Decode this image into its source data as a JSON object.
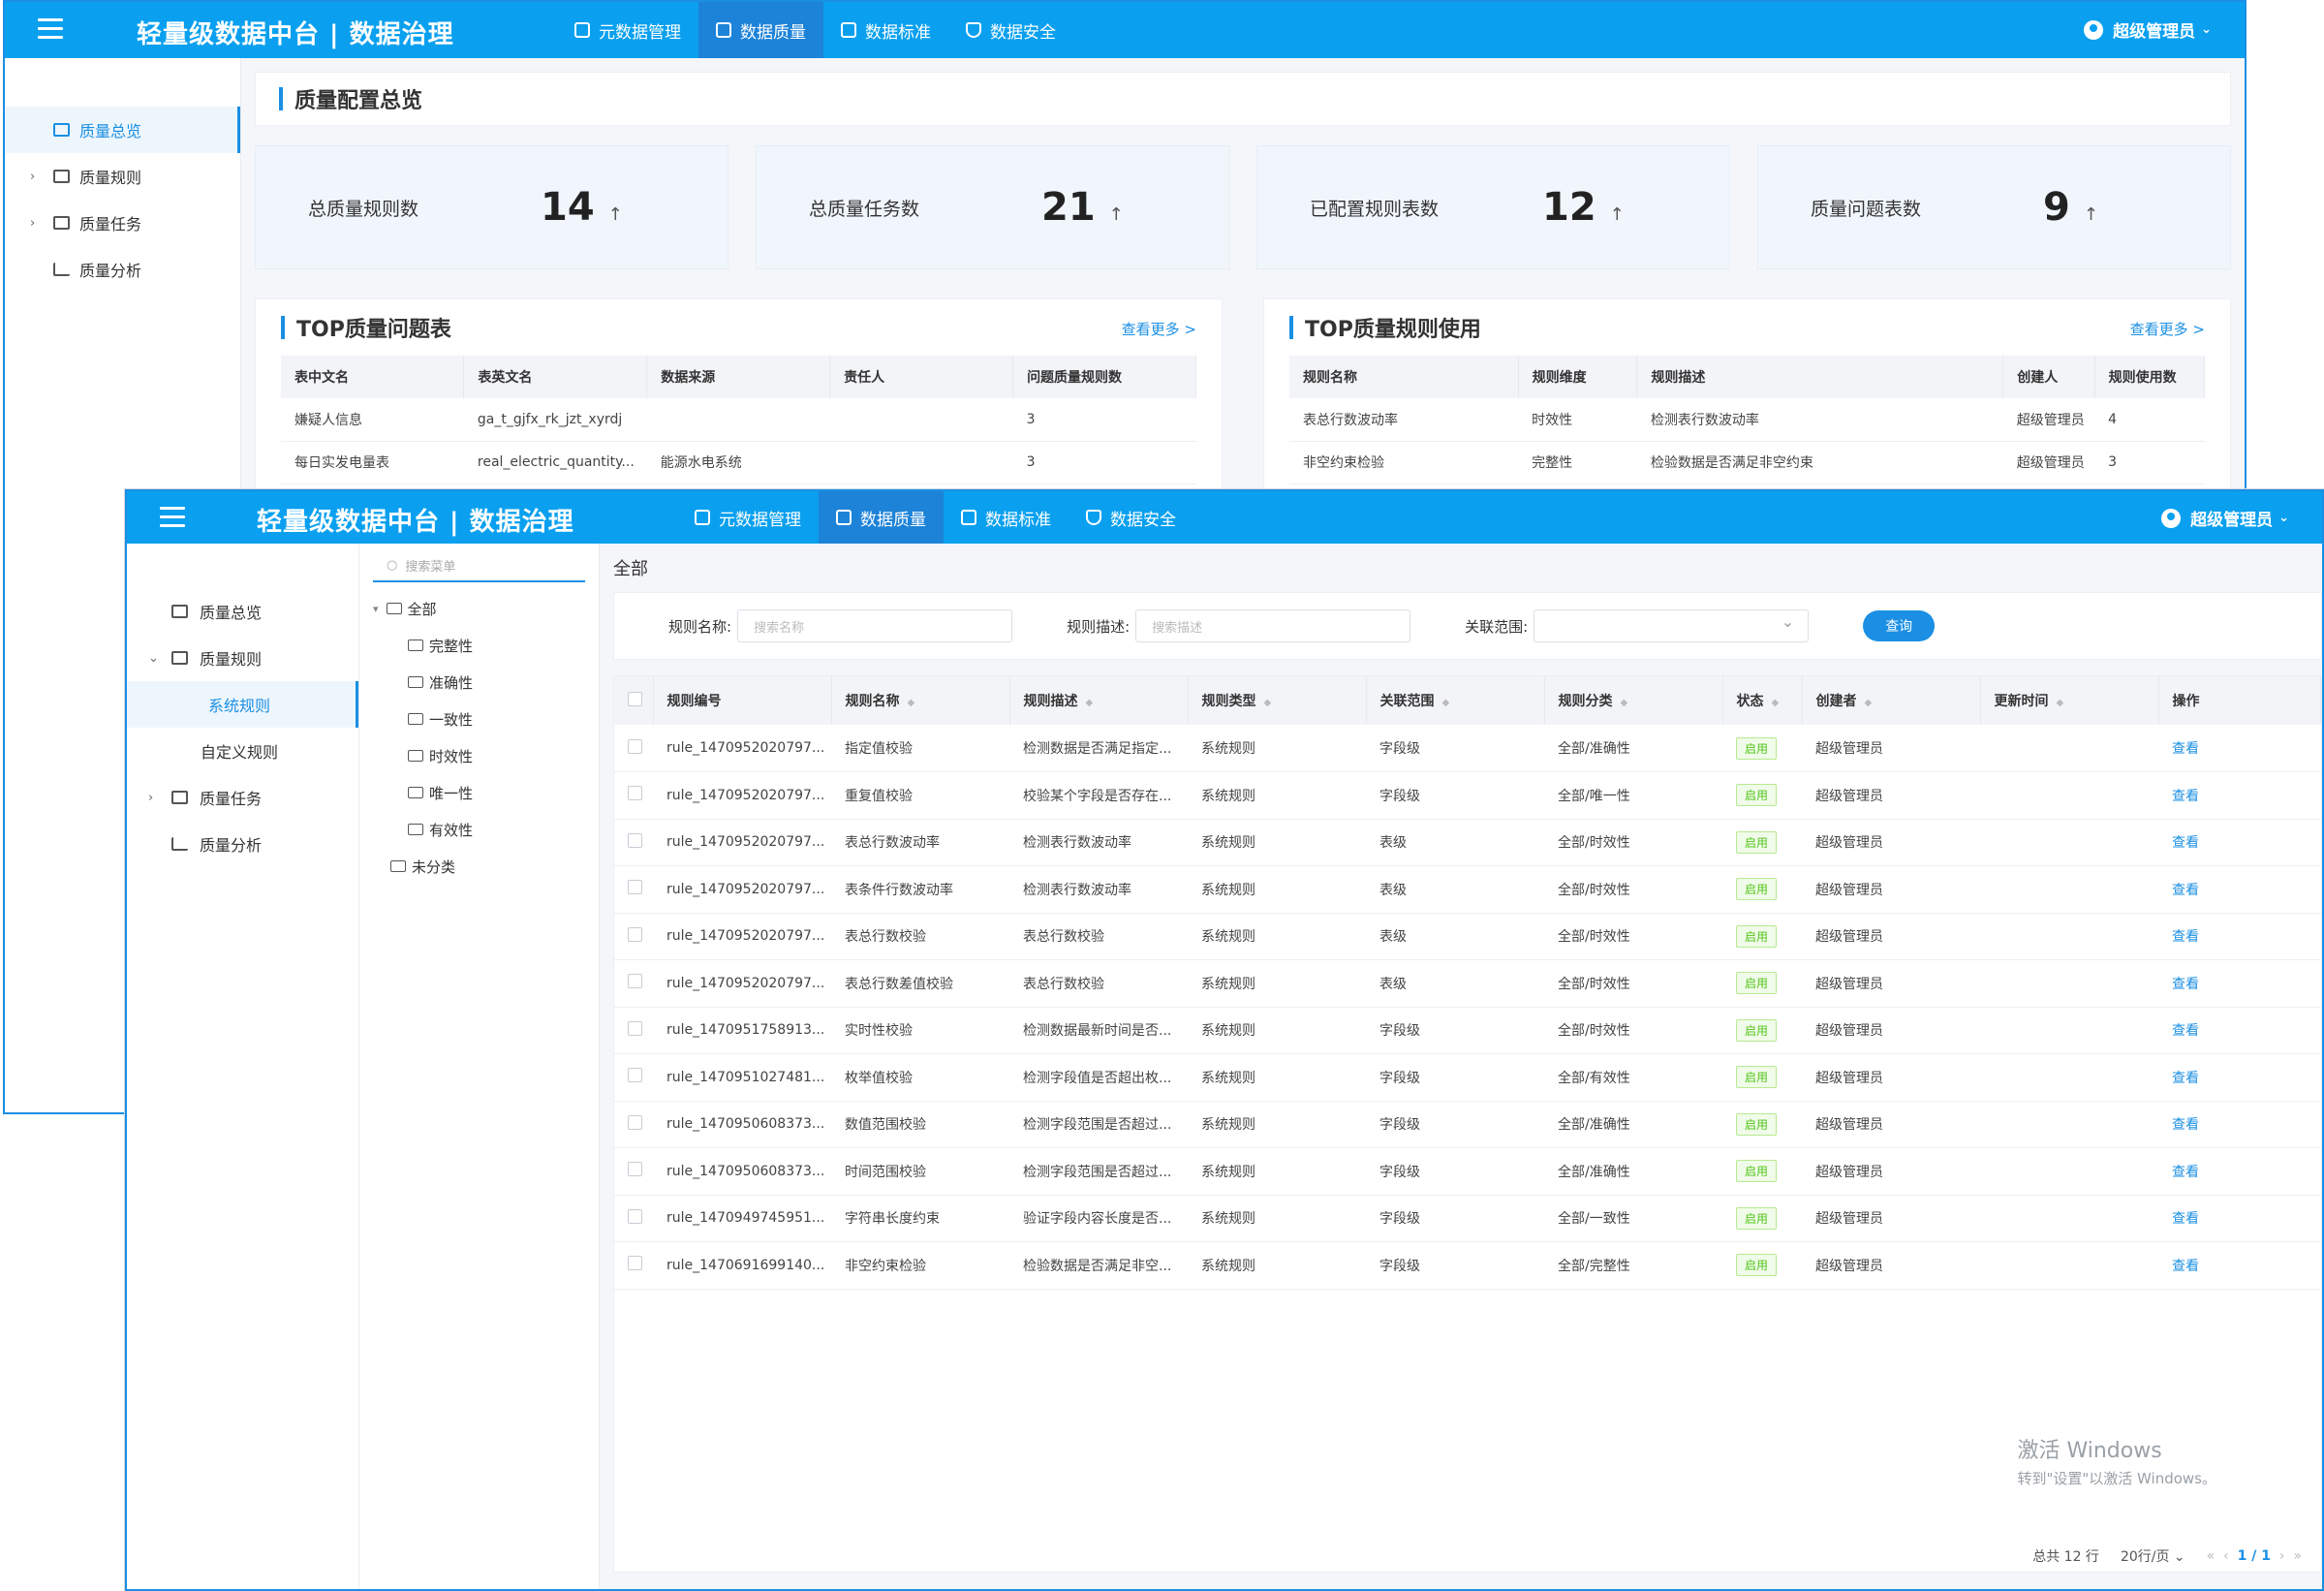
{
  "app_title": "轻量级数据中台 | 数据治理",
  "nav": [
    "元数据管理",
    "数据质量",
    "数据标准",
    "数据安全"
  ],
  "user": "超级管理员",
  "back_window": {
    "sidebar": [
      "质量总览",
      "质量规则",
      "质量任务",
      "质量分析"
    ],
    "page_title": "质量配置总览",
    "stats": [
      {
        "label": "总质量规则数",
        "value": "14",
        "arrow": "↑"
      },
      {
        "label": "总质量任务数",
        "value": "21",
        "arrow": "↑"
      },
      {
        "label": "已配置规则表数",
        "value": "12",
        "arrow": "↑"
      },
      {
        "label": "质量问题表数",
        "value": "9",
        "arrow": "↑"
      }
    ],
    "top_issue": {
      "title": "TOP质量问题表",
      "more": "查看更多 >",
      "columns": [
        "表中文名",
        "表英文名",
        "数据来源",
        "责任人",
        "问题质量规则数"
      ],
      "rows": [
        [
          "嫌疑人信息",
          "ga_t_gjfx_rk_jzt_xyrdj",
          "",
          "",
          "3"
        ],
        [
          "每日实发电量表",
          "real_electric_quantity...",
          "能源水电系统",
          "",
          "3"
        ]
      ]
    },
    "top_rule": {
      "title": "TOP质量规则使用",
      "more": "查看更多 >",
      "columns": [
        "规则名称",
        "规则维度",
        "规则描述",
        "创建人",
        "规则使用数"
      ],
      "rows": [
        [
          "表总行数波动率",
          "时效性",
          "检测表行数波动率",
          "超级管理员",
          "4"
        ],
        [
          "非空约束检验",
          "完整性",
          "检验数据是否满足非空约束",
          "超级管理员",
          "3"
        ]
      ]
    }
  },
  "front_window": {
    "sidebar": {
      "overview": "质量总览",
      "rules": "质量规则",
      "system_rules": "系统规则",
      "custom_rules": "自定义规则",
      "tasks": "质量任务",
      "analysis": "质量分析"
    },
    "tree": {
      "search_placeholder": "搜索菜单",
      "root": "全部",
      "children": [
        "完整性",
        "准确性",
        "一致性",
        "时效性",
        "唯一性",
        "有效性"
      ],
      "other": "未分类"
    },
    "crumb": "全部",
    "filter": {
      "name_label": "规则名称:",
      "name_placeholder": "搜索名称",
      "desc_label": "规则描述:",
      "desc_placeholder": "搜索描述",
      "scope_label": "关联范围:",
      "query": "查询"
    },
    "columns": [
      "规则编号",
      "规则名称",
      "规则描述",
      "规则类型",
      "关联范围",
      "规则分类",
      "状态",
      "创建者",
      "更新时间",
      "操作"
    ],
    "rows": [
      [
        "rule_1470952020797...",
        "指定值校验",
        "检测数据是否满足指定...",
        "系统规则",
        "字段级",
        "全部/准确性",
        "启用",
        "超级管理员",
        "",
        "查看"
      ],
      [
        "rule_1470952020797...",
        "重复值校验",
        "校验某个字段是否存在...",
        "系统规则",
        "字段级",
        "全部/唯一性",
        "启用",
        "超级管理员",
        "",
        "查看"
      ],
      [
        "rule_1470952020797...",
        "表总行数波动率",
        "检测表行数波动率",
        "系统规则",
        "表级",
        "全部/时效性",
        "启用",
        "超级管理员",
        "",
        "查看"
      ],
      [
        "rule_1470952020797...",
        "表条件行数波动率",
        "检测表行数波动率",
        "系统规则",
        "表级",
        "全部/时效性",
        "启用",
        "超级管理员",
        "",
        "查看"
      ],
      [
        "rule_1470952020797...",
        "表总行数校验",
        "表总行数校验",
        "系统规则",
        "表级",
        "全部/时效性",
        "启用",
        "超级管理员",
        "",
        "查看"
      ],
      [
        "rule_1470952020797...",
        "表总行数差值校验",
        "表总行数校验",
        "系统规则",
        "表级",
        "全部/时效性",
        "启用",
        "超级管理员",
        "",
        "查看"
      ],
      [
        "rule_1470951758913...",
        "实时性校验",
        "检测数据最新时间是否...",
        "系统规则",
        "字段级",
        "全部/时效性",
        "启用",
        "超级管理员",
        "",
        "查看"
      ],
      [
        "rule_1470951027481...",
        "枚举值校验",
        "检测字段值是否超出枚...",
        "系统规则",
        "字段级",
        "全部/有效性",
        "启用",
        "超级管理员",
        "",
        "查看"
      ],
      [
        "rule_1470950608373...",
        "数值范围校验",
        "检测字段范围是否超过...",
        "系统规则",
        "字段级",
        "全部/准确性",
        "启用",
        "超级管理员",
        "",
        "查看"
      ],
      [
        "rule_1470950608373...",
        "时间范围校验",
        "检测字段范围是否超过...",
        "系统规则",
        "字段级",
        "全部/准确性",
        "启用",
        "超级管理员",
        "",
        "查看"
      ],
      [
        "rule_1470949745951...",
        "字符串长度约束",
        "验证字段内容长度是否...",
        "系统规则",
        "字段级",
        "全部/一致性",
        "启用",
        "超级管理员",
        "",
        "查看"
      ],
      [
        "rule_1470691699140...",
        "非空约束检验",
        "检验数据是否满足非空...",
        "系统规则",
        "字段级",
        "全部/完整性",
        "启用",
        "超级管理员",
        "",
        "查看"
      ]
    ],
    "pager": {
      "total": "总共 12 行",
      "size": "20行/页 ⌄",
      "page": "1 / 1"
    }
  },
  "watermark": {
    "line1": "激活 Windows",
    "line2": "转到\"设置\"以激活 Windows。"
  }
}
